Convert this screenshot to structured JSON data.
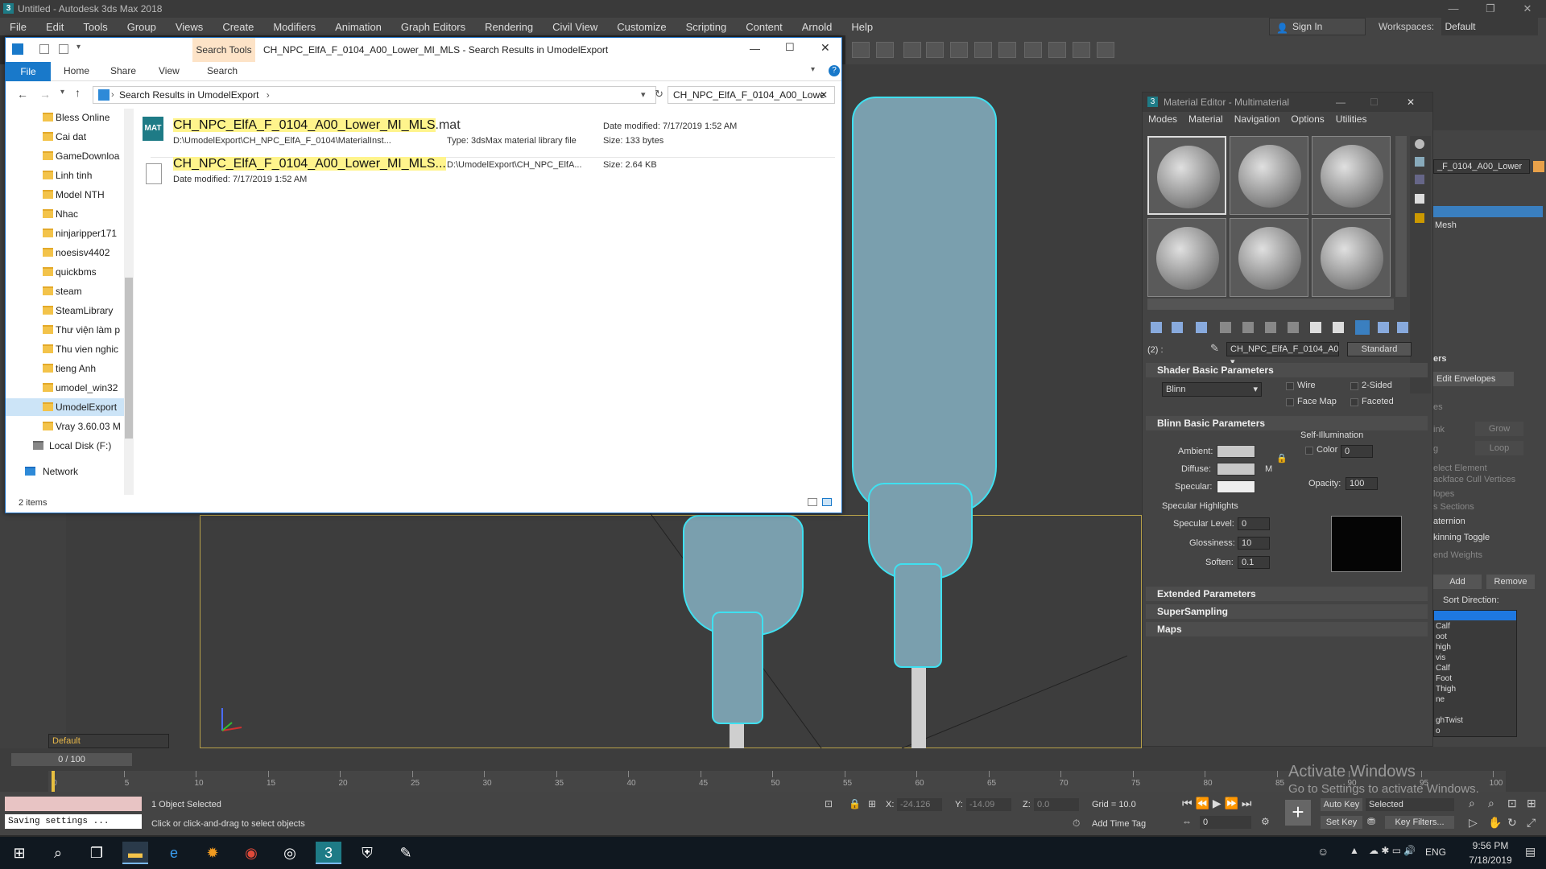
{
  "window": {
    "title": "Untitled - Autodesk 3ds Max 2018",
    "sign_in": "Sign In",
    "workspaces_label": "Workspaces:",
    "workspaces_value": "Default"
  },
  "menu": [
    "File",
    "Edit",
    "Tools",
    "Group",
    "Views",
    "Create",
    "Modifiers",
    "Animation",
    "Graph Editors",
    "Rendering",
    "Civil View",
    "Customize",
    "Scripting",
    "Content",
    "Arnold",
    "Help"
  ],
  "explorer": {
    "title": "CH_NPC_ElfA_F_0104_A00_Lower_MI_MLS - Search Results in UmodelExport",
    "search_tools_tab": "Search Tools",
    "tabs": [
      "File",
      "Home",
      "Share",
      "View",
      "Search"
    ],
    "address": "Search Results in UmodelExport",
    "search_value": "CH_NPC_ElfA_F_0104_A00_Lowe",
    "nav_items": [
      "Bless Online",
      "Cai dat",
      "GameDownloa",
      "Linh tinh",
      "Model NTH",
      "Nhac",
      "ninjaripper171",
      "noesisv4402",
      "quickbms",
      "steam",
      "SteamLibrary",
      "Thư viện làm p",
      "Thu vien nghic",
      "tieng Anh",
      "umodel_win32",
      "UmodelExport",
      "Vray 3.60.03 M",
      "Local Disk (F:)",
      "Network"
    ],
    "results": [
      {
        "name_highlight": "CH_NPC_ElfA_F_0104_A00_Lower_MI_MLS",
        "name_suffix": ".mat",
        "path": "D:\\UmodelExport\\CH_NPC_ElfA_F_0104\\MaterialInst...",
        "type": "Type:  3dsMax material library file",
        "date": "Date modified:  7/17/2019 1:52 AM",
        "size": "Size:  133 bytes"
      },
      {
        "name_highlight": "CH_NPC_ElfA_F_0104_A00_Lower_MI_MLS...",
        "name_suffix": "",
        "path": "D:\\UmodelExport\\CH_NPC_ElfA...",
        "date": "Date modified:  7/17/2019 1:52 AM",
        "size": "Size:  2.64 KB"
      }
    ],
    "status": "2 items"
  },
  "material_editor": {
    "title": "Material Editor - Multimaterial",
    "menu": [
      "Modes",
      "Material",
      "Navigation",
      "Options",
      "Utilities"
    ],
    "slot_index": "(2) :",
    "material_name": "CH_NPC_ElfA_F_0104_A0",
    "type_button": "Standard",
    "shader_rollout": "Shader Basic Parameters",
    "shader_value": "Blinn",
    "wire": "Wire",
    "two_sided": "2-Sided",
    "face_map": "Face Map",
    "faceted": "Faceted",
    "blinn_rollout": "Blinn Basic Parameters",
    "self_illum": "Self-Illumination",
    "color": "Color",
    "color_value": "0",
    "ambient": "Ambient:",
    "diffuse": "Diffuse:",
    "specular": "Specular:",
    "opacity": "Opacity:",
    "opacity_value": "100",
    "m_btn": "M",
    "spec_highlights": "Specular Highlights",
    "spec_level": "Specular Level:",
    "spec_level_value": "0",
    "glossiness": "Glossiness:",
    "glossiness_value": "10",
    "soften": "Soften:",
    "soften_value": "0.1",
    "extended": "Extended Parameters",
    "supersampling": "SuperSampling",
    "maps": "Maps"
  },
  "command_panel": {
    "material_name": "_F_0104_A00_Lower",
    "mesh": "Mesh",
    "params": "ers",
    "edit_envelopes": "Edit Envelopes",
    "ink": "ink",
    "grow": "Grow",
    "loop": "Loop",
    "g": "g",
    "elect_element": "elect Element",
    "backface": "ackface Cull Vertices",
    "lopes": "lopes",
    "sections": "s Sections",
    "es": "es",
    "aternion": "aternion",
    "skinning_toggle": "kinning Toggle",
    "end_weights": "end Weights",
    "add": "Add",
    "remove": "Remove",
    "sort_direction": "Sort Direction:",
    "bones": [
      "Calf",
      "oot",
      "high",
      "vis",
      "Calf",
      "Foot",
      "Thigh",
      "ne",
      "",
      "ghTwist",
      "o"
    ]
  },
  "timeline": {
    "frame_counter": "0 / 100",
    "ticks": [
      "0",
      "5",
      "10",
      "15",
      "20",
      "25",
      "30",
      "35",
      "40",
      "45",
      "50",
      "55",
      "60",
      "65",
      "70",
      "75",
      "80",
      "85",
      "90",
      "95",
      "100"
    ]
  },
  "status": {
    "default_layer": "Default",
    "objects_selected": "1 Object Selected",
    "prompt": "Click or click-and-drag to select objects",
    "saving": "Saving settings ...",
    "x_label": "X:",
    "x_value": "-24.126",
    "y_label": "Y:",
    "y_value": "-14.09",
    "z_label": "Z:",
    "z_value": "0.0",
    "grid": "Grid = 10.0",
    "add_time_tag": "Add Time Tag",
    "auto_key": "Auto Key",
    "selected": "Selected",
    "set_key": "Set Key",
    "key_filters": "Key Filters...",
    "frame_field": "0"
  },
  "watermark": {
    "line1": "Activate Windows",
    "line2": "Go to Settings to activate Windows."
  },
  "taskbar": {
    "time": "9:56 PM",
    "date": "7/18/2019",
    "lang": "ENG"
  },
  "colors": {
    "accent_blue": "#1979ca",
    "selection_cyan": "#3fe0f0",
    "highlight_yellow": "#fff48c",
    "viewport_bg": "#3d3d3d"
  }
}
